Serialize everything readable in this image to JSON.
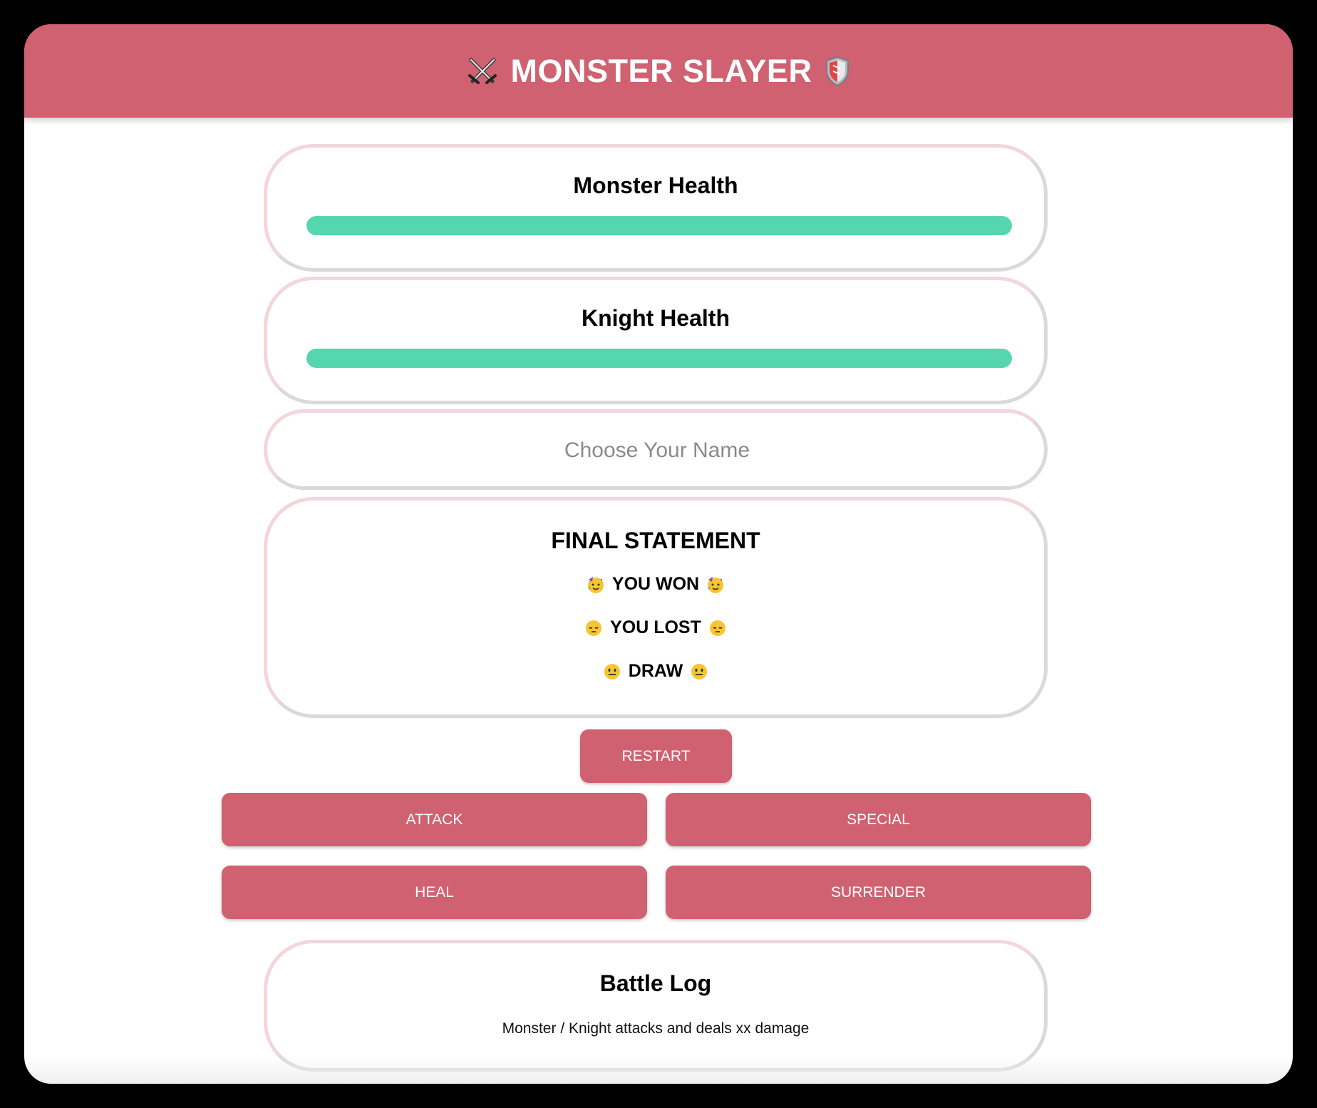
{
  "header": {
    "title": "MONSTER SLAYER",
    "left_icon": "crossed-swords-icon",
    "right_icon": "shield-icon",
    "background": "#cf6171"
  },
  "monster_panel": {
    "title": "Monster Health",
    "health_percent": 100,
    "bar_color": "#56d6ae"
  },
  "knight_panel": {
    "title": "Knight Health",
    "health_percent": 100,
    "bar_color": "#56d6ae"
  },
  "name_input": {
    "placeholder": "Choose Your Name",
    "value": ""
  },
  "final_statement": {
    "title": "FINAL STATEMENT",
    "results": [
      {
        "label": "YOU WON",
        "icon": "party-face-icon"
      },
      {
        "label": "YOU LOST",
        "icon": "pensive-face-icon"
      },
      {
        "label": "DRAW",
        "icon": "neutral-face-icon"
      }
    ]
  },
  "buttons": {
    "restart": "RESTART",
    "attack": "ATTACK",
    "special": "SPECIAL",
    "heal": "HEAL",
    "surrender": "SURRENDER",
    "color": "#cf6171"
  },
  "battle_log": {
    "title": "Battle Log",
    "entries": [
      "Monster / Knight attacks and deals xx damage"
    ]
  }
}
